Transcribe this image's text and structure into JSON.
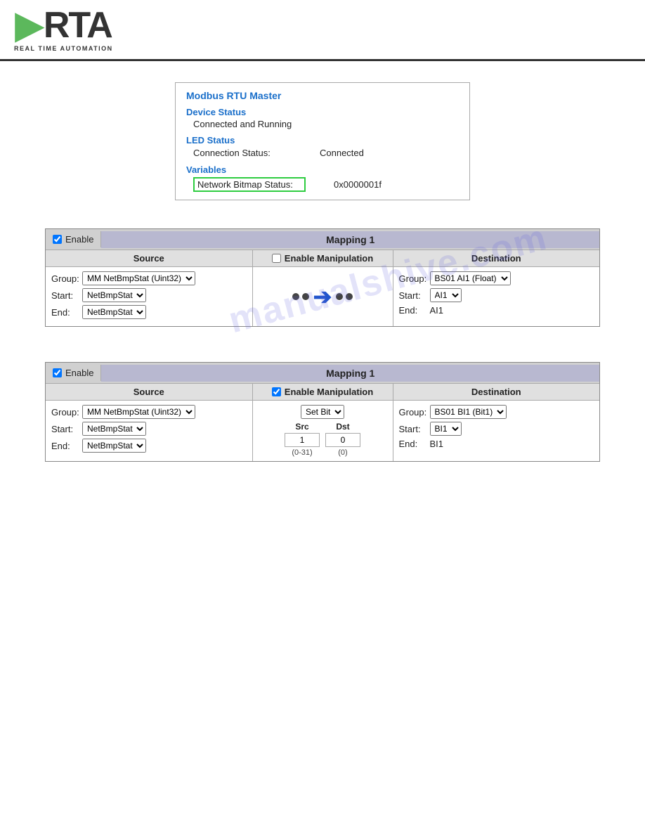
{
  "header": {
    "logo_text": "RTA",
    "logo_subtitle": "REAL TIME AUTOMATION"
  },
  "status_box": {
    "title": "Modbus RTU Master",
    "device_status_label": "Device Status",
    "device_status_value": "Connected and Running",
    "led_status_label": "LED Status",
    "connection_status_key": "Connection Status:",
    "connection_status_value": "Connected",
    "variables_label": "Variables",
    "network_bitmap_key": "Network Bitmap Status:",
    "network_bitmap_value": "0x0000001f"
  },
  "watermark": {
    "text": "manualshive.com"
  },
  "mapping1": {
    "enable_label": "Enable",
    "title": "Mapping 1",
    "source_label": "Source",
    "enable_manip_label": "Enable Manipulation",
    "destination_label": "Destination",
    "source_group_label": "Group:",
    "source_group_value": "MM NetBmpStat (Uint32)",
    "source_start_label": "Start:",
    "source_start_value": "NetBmpStat",
    "source_end_label": "End:",
    "source_end_value": "NetBmpStat",
    "dest_group_label": "Group:",
    "dest_group_value": "BS01 AI1 (Float)",
    "dest_start_label": "Start:",
    "dest_start_value": "AI1",
    "dest_end_label": "End:",
    "dest_end_value": "AI1"
  },
  "mapping2": {
    "enable_label": "Enable",
    "title": "Mapping 1",
    "source_label": "Source",
    "enable_manip_label": "Enable Manipulation",
    "destination_label": "Destination",
    "source_group_label": "Group:",
    "source_group_value": "MM NetBmpStat (Uint32)",
    "source_start_label": "Start:",
    "source_start_value": "NetBmpStat",
    "source_end_label": "End:",
    "source_end_value": "NetBmpStat",
    "manip_type": "Set Bit",
    "src_label": "Src",
    "dst_label": "Dst",
    "src_value": "1",
    "dst_value": "0",
    "src_range": "(0-31)",
    "dst_range": "(0)",
    "dest_group_label": "Group:",
    "dest_group_value": "BS01 BI1 (Bit1)",
    "dest_start_label": "Start:",
    "dest_start_value": "BI1",
    "dest_end_label": "End:",
    "dest_end_value": "BI1"
  }
}
